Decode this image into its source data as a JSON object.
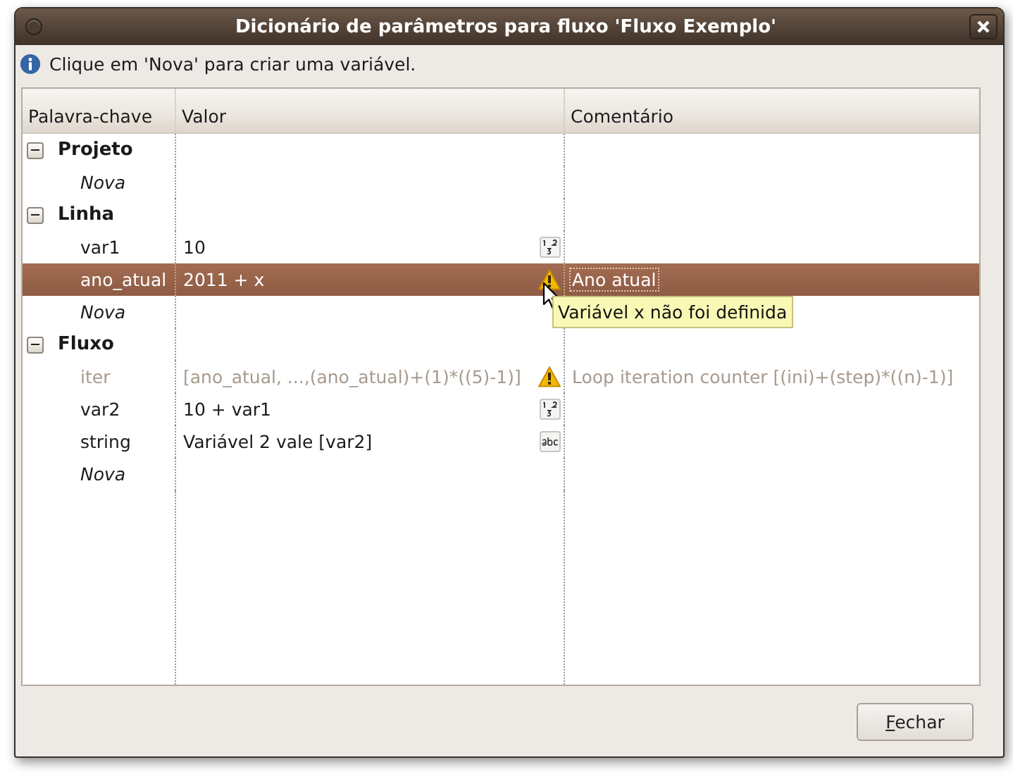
{
  "window": {
    "title": "Dicionário de parâmetros para fluxo 'Fluxo Exemplo'"
  },
  "info": "Clique em 'Nova' para criar uma variável.",
  "table": {
    "columns": [
      "Palavra-chave",
      "Valor",
      "Comentário"
    ],
    "groups": [
      {
        "name": "Projeto",
        "expanded": true,
        "rows": [
          {
            "kind": "new",
            "key": "Nova"
          }
        ]
      },
      {
        "name": "Linha",
        "expanded": true,
        "rows": [
          {
            "kind": "number",
            "key": "var1",
            "value": "10",
            "selected": false,
            "disabled": false
          },
          {
            "kind": "warning",
            "key": "ano_atual",
            "value": "2011 + x",
            "comment": "Ano atual",
            "selected": true,
            "disabled": false
          },
          {
            "kind": "new",
            "key": "Nova"
          }
        ]
      },
      {
        "name": "Fluxo",
        "expanded": true,
        "rows": [
          {
            "kind": "warning",
            "key": "iter",
            "value": "[ano_atual, ...,(ano_atual)+(1)*((5)-1)]",
            "comment": "Loop iteration counter [(ini)+(step)*((n)-1)]",
            "selected": false,
            "disabled": true
          },
          {
            "kind": "number",
            "key": "var2",
            "value": "10 + var1",
            "selected": false,
            "disabled": false
          },
          {
            "kind": "string",
            "key": "string",
            "value": "Variável 2 vale [var2]",
            "selected": false,
            "disabled": false
          },
          {
            "kind": "new",
            "key": "Nova"
          }
        ]
      }
    ]
  },
  "tooltip": "Variável x não foi definida",
  "buttons": [
    {
      "label": "Fechar",
      "mnemonic_underlined": true
    }
  ]
}
